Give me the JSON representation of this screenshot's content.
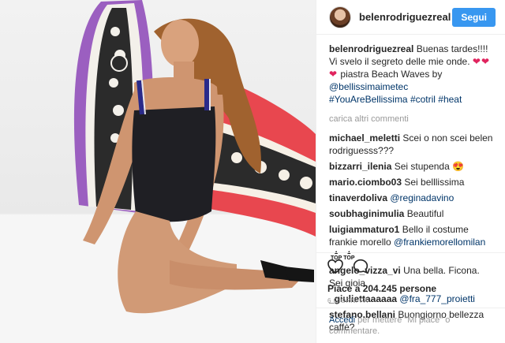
{
  "post": {
    "username": "belenrodriguezreal",
    "follow_label": "Segui",
    "caption_user": "belenrodriguezreal",
    "caption_text": " Buenas tardes!!!! Vi svelo il segreto delle mie onde. ",
    "caption_hearts": "❤❤❤",
    "caption_text2": " piastra Beach Waves by ",
    "caption_mention": "@bellissimaimetec",
    "caption_tags": "#YouAreBellissima #cotril #heat",
    "load_more": "carica altri commenti"
  },
  "comments": [
    {
      "user": "michael_meletti",
      "text": "Scei o non scei belen rodriguesss???"
    },
    {
      "user": "bizzarri_ilenia",
      "text": "Sei stupenda 😍"
    },
    {
      "user": "mario.ciombo03",
      "text": "Sei belllissima"
    },
    {
      "user": "tinaverdoliva",
      "mention": "@reginadavino"
    },
    {
      "user": "soubhaginimulia",
      "text": "Beautiful"
    },
    {
      "user": "luigiammaturo1",
      "text": "Bello il costume frankie morello ",
      "mention": "@frankiemorellomilan",
      "icon": "TOP"
    },
    {
      "user": "angelo_vizza_vi",
      "text": "Una bella. Ficona. Sei gioia"
    },
    {
      "user": "_giuliettaaaaaa",
      "mention": "@fra_777_proietti"
    },
    {
      "user": "stefano.bellani",
      "text": "Buongiorno bellezza caffè?"
    }
  ],
  "actions": {
    "likes": "Piace a 204.245 persone",
    "timestamp": "6 GIORNI FA",
    "like_icon": "heart-icon",
    "comment_icon": "comment-icon"
  },
  "login": {
    "link": "Accedi",
    "text": " per mettere \"Mi piace\" o commentare."
  },
  "colors": {
    "follow_button": "#3897f0",
    "link": "#003569",
    "muted": "#999999",
    "board_purple": "#9b5fc0",
    "board_red": "#e8474f"
  }
}
